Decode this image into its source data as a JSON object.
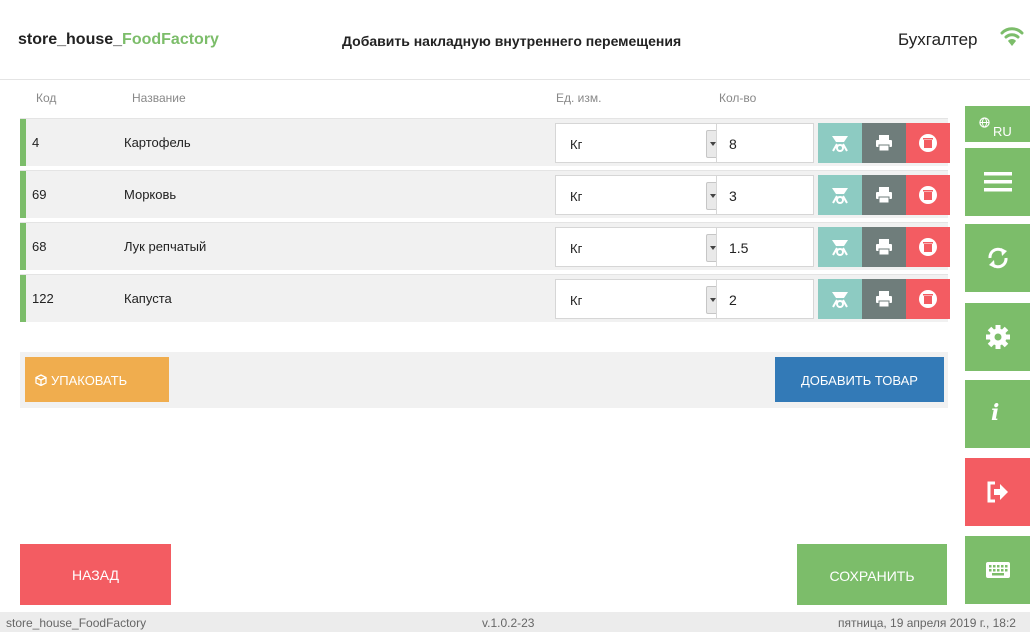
{
  "header": {
    "brand_prefix": "store_house_",
    "brand_accent": "FoodFactory",
    "title": "Добавить накладную внутреннего перемещения",
    "user_role": "Бухгалтер"
  },
  "columns": {
    "code": "Код",
    "name": "Название",
    "unit": "Ед. изм.",
    "qty": "Кол-во"
  },
  "rows": [
    {
      "code": "4",
      "name": "Картофель",
      "unit": "Кг",
      "qty": "8"
    },
    {
      "code": "69",
      "name": "Морковь",
      "unit": "Кг",
      "qty": "3"
    },
    {
      "code": "68",
      "name": "Лук репчатый",
      "unit": "Кг",
      "qty": "1.5"
    },
    {
      "code": "122",
      "name": "Капуста",
      "unit": "Кг",
      "qty": "2"
    }
  ],
  "actions": {
    "pack": "УПАКОВАТЬ",
    "add": "ДОБАВИТЬ ТОВАР",
    "back": "НАЗАД",
    "save": "СОХРАНИТЬ"
  },
  "sidebar": {
    "lang": "RU",
    "info": "i"
  },
  "footer": {
    "app": "store_house_FoodFactory",
    "version": "v.1.0.2-23",
    "datetime": "пятница, 19 апреля 2019 г., 18:2"
  },
  "colors": {
    "green": "#7cbd6a",
    "red": "#f35c62",
    "orange": "#f0ad4e",
    "blue": "#337ab7",
    "teal": "#8dcbc2",
    "gray": "#6f7d7b"
  },
  "icons": [
    "wifi-icon",
    "globe-icon",
    "menu-icon",
    "sync-icon",
    "gear-icon",
    "info-icon",
    "logout-icon",
    "keyboard-icon",
    "scale-icon",
    "print-icon",
    "delete-icon",
    "box-icon"
  ]
}
